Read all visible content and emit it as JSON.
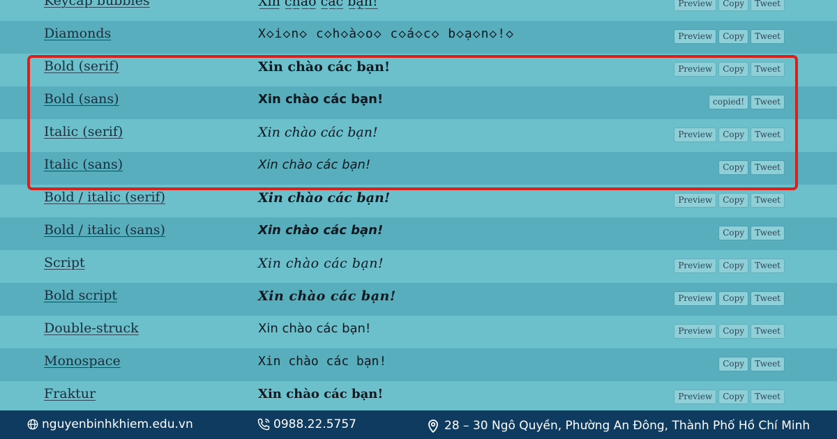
{
  "rows": [
    {
      "name": "Keycap bubbles",
      "sample": "X̲i̲n̲ c̲h̲à̲o̲ c̲á̲c̲ b̲ạ̲n̲!̲",
      "style": "s-normal",
      "buttons": [
        "Preview",
        "Copy",
        "Tweet"
      ]
    },
    {
      "name": "Diamonds",
      "sample": "X◇i◇n◇ c◇h◇à◇o◇ c◇á◇c◇ b◇ạ◇n◇!◇",
      "style": "s-diamond",
      "buttons": [
        "Preview",
        "Copy",
        "Tweet"
      ]
    },
    {
      "name": "Bold (serif)",
      "sample": "Xin chào các bạn!",
      "style": "s-bold-serif",
      "buttons": [
        "Preview",
        "Copy",
        "Tweet"
      ]
    },
    {
      "name": "Bold (sans)",
      "sample": "Xin chào các bạn!",
      "style": "s-bold-sans",
      "buttons": [
        "copied!",
        "Tweet"
      ]
    },
    {
      "name": "Italic (serif)",
      "sample": "Xin chào các bạn!",
      "style": "s-italic-serif",
      "buttons": [
        "Preview",
        "Copy",
        "Tweet"
      ]
    },
    {
      "name": "Italic (sans)",
      "sample": "Xin chào các bạn!",
      "style": "s-italic-sans",
      "buttons": [
        "Copy",
        "Tweet"
      ]
    },
    {
      "name": "Bold / italic (serif)",
      "sample": "Xin chào các bạn!",
      "style": "s-bi-serif",
      "buttons": [
        "Preview",
        "Copy",
        "Tweet"
      ]
    },
    {
      "name": "Bold / italic (sans)",
      "sample": "Xin chào các bạn!",
      "style": "s-bi-sans",
      "buttons": [
        "Copy",
        "Tweet"
      ]
    },
    {
      "name": "Script",
      "sample": "Xin chào các bạn!",
      "style": "s-script",
      "buttons": [
        "Preview",
        "Copy",
        "Tweet"
      ]
    },
    {
      "name": "Bold script",
      "sample": "Xin chào các bạn!",
      "style": "s-bold-script",
      "buttons": [
        "Preview",
        "Copy",
        "Tweet"
      ]
    },
    {
      "name": "Double-struck",
      "sample": "Xin chào các bạn!",
      "style": "s-double",
      "buttons": [
        "Preview",
        "Copy",
        "Tweet"
      ]
    },
    {
      "name": "Monospace",
      "sample": "Xin chào các bạn!",
      "style": "s-mono",
      "buttons": [
        "Copy",
        "Tweet"
      ]
    },
    {
      "name": "Fraktur",
      "sample": "Xin chào các bạn!",
      "style": "s-fraktur",
      "buttons": [
        "Preview",
        "Copy",
        "Tweet"
      ]
    }
  ],
  "footer": {
    "website": "nguyenbinhkhiem.edu.vn",
    "phone": "0988.22.5757",
    "address": "28 – 30 Ngô Quyền, Phường An Đông, Thành Phố Hồ Chí Minh"
  },
  "colors": {
    "highlight": "#d6221d",
    "footer_bg": "#0e3b5f",
    "row_light": "#6cc0cb",
    "row_dark": "#58aebc"
  },
  "icons": {
    "website": "globe-icon",
    "phone": "phone-icon",
    "address": "map-pin-icon"
  }
}
